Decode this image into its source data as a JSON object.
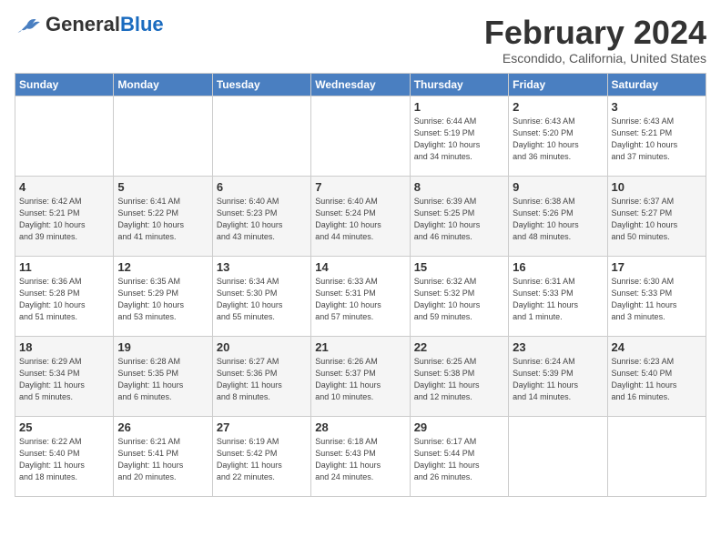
{
  "header": {
    "logo_general": "General",
    "logo_blue": "Blue",
    "month": "February 2024",
    "location": "Escondido, California, United States"
  },
  "weekdays": [
    "Sunday",
    "Monday",
    "Tuesday",
    "Wednesday",
    "Thursday",
    "Friday",
    "Saturday"
  ],
  "weeks": [
    [
      {
        "day": "",
        "info": ""
      },
      {
        "day": "",
        "info": ""
      },
      {
        "day": "",
        "info": ""
      },
      {
        "day": "",
        "info": ""
      },
      {
        "day": "1",
        "info": "Sunrise: 6:44 AM\nSunset: 5:19 PM\nDaylight: 10 hours\nand 34 minutes."
      },
      {
        "day": "2",
        "info": "Sunrise: 6:43 AM\nSunset: 5:20 PM\nDaylight: 10 hours\nand 36 minutes."
      },
      {
        "day": "3",
        "info": "Sunrise: 6:43 AM\nSunset: 5:21 PM\nDaylight: 10 hours\nand 37 minutes."
      }
    ],
    [
      {
        "day": "4",
        "info": "Sunrise: 6:42 AM\nSunset: 5:21 PM\nDaylight: 10 hours\nand 39 minutes."
      },
      {
        "day": "5",
        "info": "Sunrise: 6:41 AM\nSunset: 5:22 PM\nDaylight: 10 hours\nand 41 minutes."
      },
      {
        "day": "6",
        "info": "Sunrise: 6:40 AM\nSunset: 5:23 PM\nDaylight: 10 hours\nand 43 minutes."
      },
      {
        "day": "7",
        "info": "Sunrise: 6:40 AM\nSunset: 5:24 PM\nDaylight: 10 hours\nand 44 minutes."
      },
      {
        "day": "8",
        "info": "Sunrise: 6:39 AM\nSunset: 5:25 PM\nDaylight: 10 hours\nand 46 minutes."
      },
      {
        "day": "9",
        "info": "Sunrise: 6:38 AM\nSunset: 5:26 PM\nDaylight: 10 hours\nand 48 minutes."
      },
      {
        "day": "10",
        "info": "Sunrise: 6:37 AM\nSunset: 5:27 PM\nDaylight: 10 hours\nand 50 minutes."
      }
    ],
    [
      {
        "day": "11",
        "info": "Sunrise: 6:36 AM\nSunset: 5:28 PM\nDaylight: 10 hours\nand 51 minutes."
      },
      {
        "day": "12",
        "info": "Sunrise: 6:35 AM\nSunset: 5:29 PM\nDaylight: 10 hours\nand 53 minutes."
      },
      {
        "day": "13",
        "info": "Sunrise: 6:34 AM\nSunset: 5:30 PM\nDaylight: 10 hours\nand 55 minutes."
      },
      {
        "day": "14",
        "info": "Sunrise: 6:33 AM\nSunset: 5:31 PM\nDaylight: 10 hours\nand 57 minutes."
      },
      {
        "day": "15",
        "info": "Sunrise: 6:32 AM\nSunset: 5:32 PM\nDaylight: 10 hours\nand 59 minutes."
      },
      {
        "day": "16",
        "info": "Sunrise: 6:31 AM\nSunset: 5:33 PM\nDaylight: 11 hours\nand 1 minute."
      },
      {
        "day": "17",
        "info": "Sunrise: 6:30 AM\nSunset: 5:33 PM\nDaylight: 11 hours\nand 3 minutes."
      }
    ],
    [
      {
        "day": "18",
        "info": "Sunrise: 6:29 AM\nSunset: 5:34 PM\nDaylight: 11 hours\nand 5 minutes."
      },
      {
        "day": "19",
        "info": "Sunrise: 6:28 AM\nSunset: 5:35 PM\nDaylight: 11 hours\nand 6 minutes."
      },
      {
        "day": "20",
        "info": "Sunrise: 6:27 AM\nSunset: 5:36 PM\nDaylight: 11 hours\nand 8 minutes."
      },
      {
        "day": "21",
        "info": "Sunrise: 6:26 AM\nSunset: 5:37 PM\nDaylight: 11 hours\nand 10 minutes."
      },
      {
        "day": "22",
        "info": "Sunrise: 6:25 AM\nSunset: 5:38 PM\nDaylight: 11 hours\nand 12 minutes."
      },
      {
        "day": "23",
        "info": "Sunrise: 6:24 AM\nSunset: 5:39 PM\nDaylight: 11 hours\nand 14 minutes."
      },
      {
        "day": "24",
        "info": "Sunrise: 6:23 AM\nSunset: 5:40 PM\nDaylight: 11 hours\nand 16 minutes."
      }
    ],
    [
      {
        "day": "25",
        "info": "Sunrise: 6:22 AM\nSunset: 5:40 PM\nDaylight: 11 hours\nand 18 minutes."
      },
      {
        "day": "26",
        "info": "Sunrise: 6:21 AM\nSunset: 5:41 PM\nDaylight: 11 hours\nand 20 minutes."
      },
      {
        "day": "27",
        "info": "Sunrise: 6:19 AM\nSunset: 5:42 PM\nDaylight: 11 hours\nand 22 minutes."
      },
      {
        "day": "28",
        "info": "Sunrise: 6:18 AM\nSunset: 5:43 PM\nDaylight: 11 hours\nand 24 minutes."
      },
      {
        "day": "29",
        "info": "Sunrise: 6:17 AM\nSunset: 5:44 PM\nDaylight: 11 hours\nand 26 minutes."
      },
      {
        "day": "",
        "info": ""
      },
      {
        "day": "",
        "info": ""
      }
    ]
  ]
}
